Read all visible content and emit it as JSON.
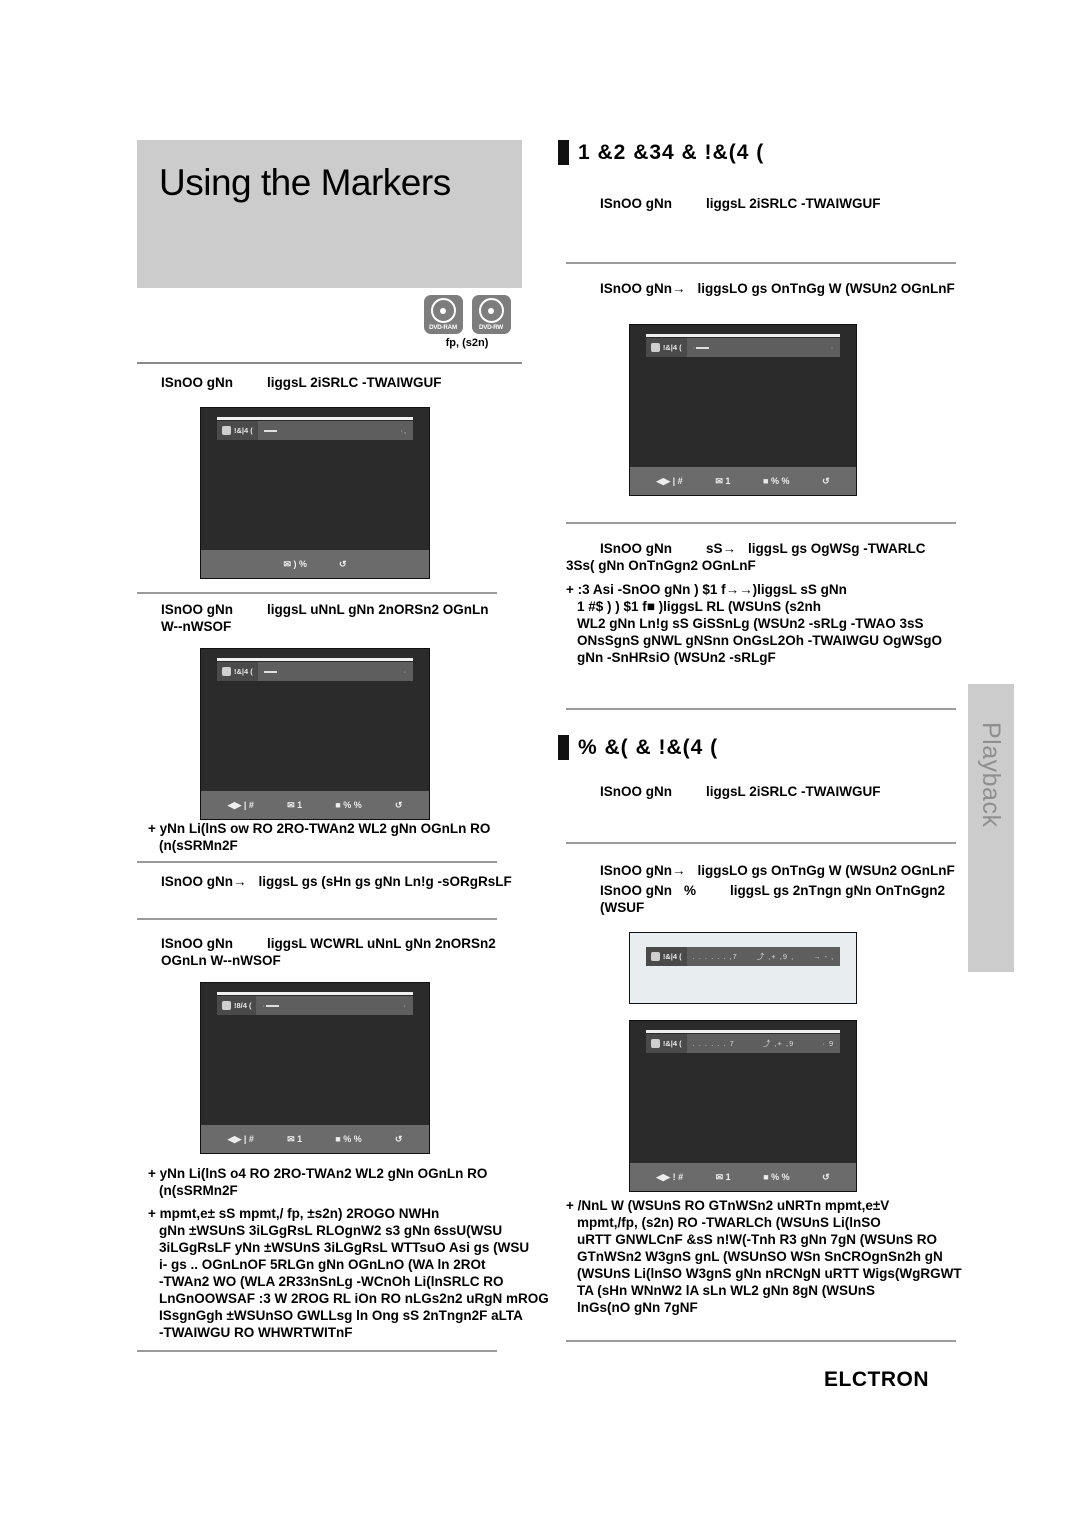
{
  "page": {
    "title": "Using the Markers",
    "disc_caption": "fp, (s2n)",
    "disc_badges": [
      {
        "label": "DVD-RAM"
      },
      {
        "label": "DVD-RW"
      }
    ],
    "side_tab": "Playback",
    "footer_brand": "ELCTRON",
    "accent_color": "#cccccc",
    "rule_color": "#8a8a8a"
  },
  "left": {
    "step1": {
      "label": "ISnOO gNn",
      "text": "liggsL 2iSRLC -TWAIWGUF"
    },
    "screenshot1": {
      "id_label": "!&|4 (",
      "field_left": "",
      "field_right": "·,",
      "footer_items": [
        "✉ ) %",
        "↺"
      ]
    },
    "step2": {
      "label": "ISnOO gNn",
      "text": "liggsL uNnL gNn 2nORSn2 OGnLn",
      "line2": "W--nWSOF"
    },
    "screenshot2": {
      "id_label": "!&|4 (",
      "field_left": "",
      "field_right": "·",
      "footer_items": [
        "◀▶ | #",
        "✉ 1",
        "■ % %",
        "↺"
      ]
    },
    "note1": {
      "line1": "+ yNn Li(lnS ow RO 2RO-TWAn2 WL2 gNn OGnLn RO",
      "line2": "(n(sSRMn2F"
    },
    "step3": {
      "label": "ISnOO gNn→",
      "text": "liggsL gs (sHn gs gNn Ln!g -sORgRsLF"
    },
    "step4": {
      "label": "ISnOO gNn",
      "text": "liggsL WCWRL uNnL gNn 2nORSn2",
      "line2": "OGnLn W--nWSOF"
    },
    "screenshot3": {
      "id_label": "!8/4 (",
      "field_left": "·",
      "field_right": "·",
      "footer_items": [
        "◀▶ | #",
        "✉ 1",
        "■ % %",
        "↺"
      ]
    },
    "note2": {
      "line1": "+ yNn Li(lnS o4 RO 2RO-TWAn2 WL2 gNn OGnLn RO",
      "line2": "(n(sSRMn2F"
    },
    "note3": {
      "lines": [
        "+ mpmt,e± sS mpmt,/ fp, ±s2n) 2ROGO NWHn",
        "gNn ±WSUnS 3iLGgRsL RLOgnW2 s3 gNn 6ssU(WSU",
        "3iLGgRsLF yNn ±WSUnS 3iLGgRsL WTTsuO Asi gs (WSU",
        "i- gs .. OGnLnOF 5RLGn gNn OGnLnO (WA ln 2ROt",
        "-TWAn2 WO (WLA 2R33nSnLg -WCnOh Li(lnSRLC RO",
        "LnGnOOWSAF :3 W 2ROG RL iOn RO nLGs2n2 uRgN mROG",
        "ISsgnGgh ±WSUnSO GWLLsg ln Ong sS 2nTngn2F aLTA",
        "-TWAIWGU RO WHWRTWITnF"
      ]
    }
  },
  "right": {
    "section1_head": "1 &2    &34 & !&(4 (",
    "step1": {
      "label": "ISnOO gNn",
      "text": "liggsL 2iSRLC -TWAIWGUF"
    },
    "step2": {
      "label": "ISnOO gNn→",
      "text": "liggsLO gs OnTnGg W (WSUn2 OGnLnF"
    },
    "screenshot1": {
      "id_label": "!&|4 (",
      "field_left": "·",
      "field_right": "·",
      "footer_items": [
        "◀▶ | #",
        "✉ 1",
        "■ % %",
        "↺"
      ]
    },
    "step3": {
      "label": "ISnOO gNn",
      "mid": "sS→",
      "text": "liggsL gs OgWSg -TWARLC",
      "line2": "3Ss( gNn OnTnGgn2 OGnLnF"
    },
    "note1": {
      "lines": [
        "+ :3 Asi -SnOO gNn ) $1        f→→)liggsL sS gNn",
        "1 #$ ) ) $1          f■ )liggsL RL (WSUnS (s2nh",
        "WL2 gNn Ln!g sS GiSSnLg (WSUn2 -sRLg -TWAO 3sS",
        "ONsSgnS gNWL gNSnn OnGsL2Oh -TWAIWGU OgWSgO",
        "gNn -SnHRsiO (WSUn2 -sRLgF"
      ]
    },
    "section2_head": "%  &(    & !&(4 (",
    "step4": {
      "label": "ISnOO gNn",
      "text": "liggsL 2iSRLC -TWAIWGUF"
    },
    "step5": {
      "label": "ISnOO gNn→",
      "text": "liggsLO gs OnTnGg W (WSUn2 OGnLnF"
    },
    "step6": {
      "label": "ISnOO gNn",
      "mid": "%",
      "text": "liggsL gs 2nTngn gNn OnTnGgn2",
      "line2": "(WSUF"
    },
    "screenshot2_light": {
      "id_label": "!&|4 (",
      "field_dots": ". . . . . . ,7",
      "field_mid": "⤴ ,+ ,9 ,",
      "field_right": "→ - ,"
    },
    "screenshot3": {
      "id_label": "!&|4 (",
      "field_dots": ". . . . . . 7",
      "field_mid": "⤴ ,+ ,9",
      "field_right": "· 9",
      "footer_items": [
        "◀▶ ! #",
        "✉ 1",
        "■ % %",
        "↺"
      ]
    },
    "note2": {
      "lines": [
        "+ /NnL W (WSUnS RO GTnWSn2 uNRTn mpmt,e±V",
        "mpmt,/fp, (s2n) RO -TWARLCh (WSUnS Li(lnSO",
        "uRTT GNWLCnF &sS n!W(-Tnh R3 gNn 7gN (WSUnS RO",
        "GTnWSn2 W3gnS gnL (WSUnSO WSn SnCROgnSn2h gN",
        "(WSUnS Li(lnSO W3gnS gNn nRCNgN uRTT Wigs(WgRGWT",
        "TA (sHn WNnW2 lA sLn WL2 gNn 8gN (WSUnS",
        "lnGs(nO gNn 7gNF"
      ]
    }
  }
}
